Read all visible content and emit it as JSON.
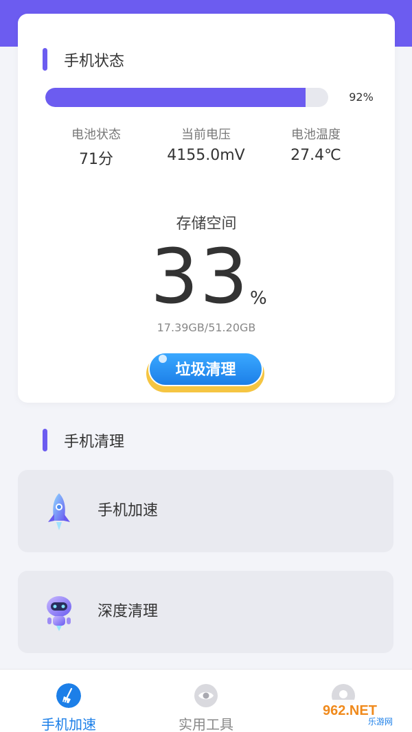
{
  "colors": {
    "accent": "#6c5cf0",
    "button_blue": "#1c7fe8",
    "button_rim": "#f5c542",
    "card_bg": "#ffffff",
    "tool_bg": "#e9eaf0",
    "nav_active": "#1c7fe8",
    "nav_inactive": "#888888"
  },
  "phone_status": {
    "title": "手机状态",
    "progress_value": 0.92,
    "progress_text": "92%",
    "stats": [
      {
        "label": "电池状态",
        "value": "71分"
      },
      {
        "label": "当前电压",
        "value": "4155.0mV"
      },
      {
        "label": "电池温度",
        "value": "27.4℃"
      }
    ],
    "storage": {
      "label": "存储空间",
      "percent": "33",
      "unit": "%",
      "detail": "17.39GB/51.20GB"
    },
    "clean_button": "垃圾清理"
  },
  "phone_clean": {
    "title": "手机清理",
    "items": [
      {
        "label": "手机加速",
        "icon": "rocket-icon"
      },
      {
        "label": "深度清理",
        "icon": "robot-icon"
      }
    ]
  },
  "bottom_nav": {
    "items": [
      {
        "label": "手机加速",
        "icon": "broom-icon",
        "active": true
      },
      {
        "label": "实用工具",
        "icon": "eye-icon",
        "active": false
      },
      {
        "label": "",
        "icon": "settings-icon",
        "active": false
      }
    ]
  },
  "watermark": {
    "text": "962.NET",
    "subtext": "乐游网"
  }
}
